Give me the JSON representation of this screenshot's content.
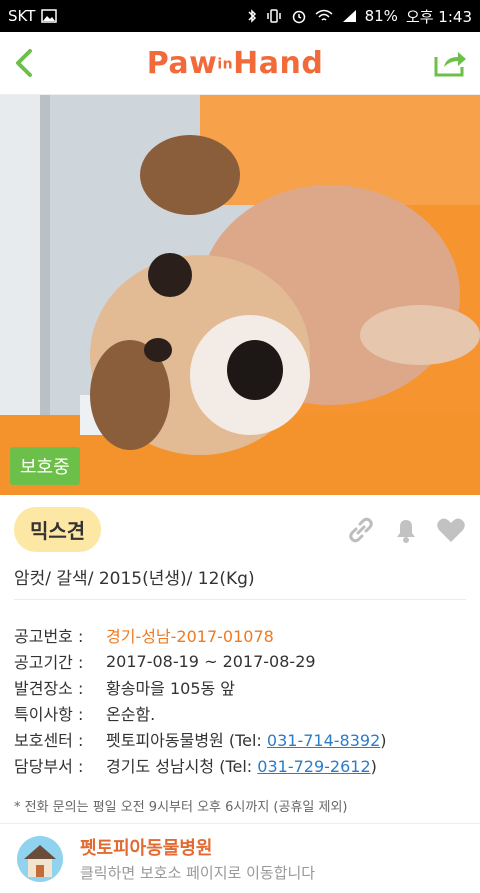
{
  "status": {
    "carrier": "SKT",
    "time": "오후 1:43",
    "battery": "81%",
    "icons": [
      "image-icon",
      "bluetooth-icon",
      "vibrate-icon",
      "alarm-icon",
      "wifi-icon",
      "signal-icon",
      "battery-icon"
    ]
  },
  "header": {
    "back_icon": "chevron-left-icon",
    "logo_text_left": "Paw",
    "logo_text_mid": "in",
    "logo_text_right": "Hand",
    "share_icon": "share-icon"
  },
  "pet": {
    "status_badge": "보호중",
    "breed": "믹스견",
    "summary": "암컷/ 갈색/ 2015(년생)/ 12(Kg)"
  },
  "details": [
    {
      "label": "공고번호 :",
      "value": "경기-성남-2017-01078"
    },
    {
      "label": "공고기간 :",
      "value": "2017-08-19 ~ 2017-08-29"
    },
    {
      "label": "발견장소 :",
      "value": "황송마을 105동 앞"
    },
    {
      "label": "특이사항 :",
      "value": "온순함."
    },
    {
      "label": "보호센터 :",
      "value": "펫토피아동물병원 (Tel: ",
      "tel": "031-714-8392",
      "after": ")"
    },
    {
      "label": "담당부서 :",
      "value": "경기도 성남시청 (Tel: ",
      "tel": "031-729-2612",
      "after": ")"
    }
  ],
  "note": "* 전화 문의는 평일 오전 9시부터 오후 6시까지 (공휴일 제외)",
  "center": {
    "name": "펫토피아동물병원",
    "subtitle": "클릭하면 보호소 페이지로 이동합니다"
  },
  "colors": {
    "brand": "#f06a3a",
    "accent_green": "#6cc04a",
    "link": "#2d7cc9",
    "highlight": "#ef7a21"
  }
}
